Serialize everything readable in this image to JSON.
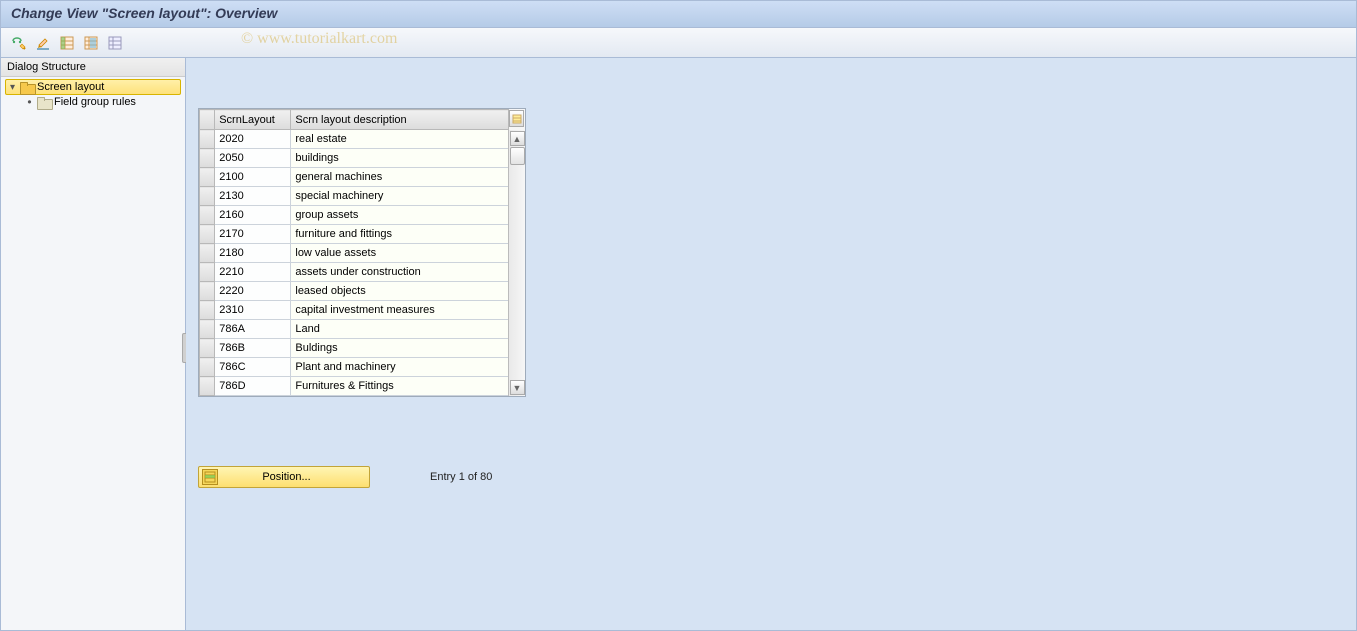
{
  "title": "Change View \"Screen layout\": Overview",
  "watermark": "© www.tutorialkart.com",
  "toolbar": {
    "icons": [
      "glasses-pencil",
      "pencil-underline",
      "table-select",
      "table-save",
      "table-list"
    ]
  },
  "sidebar": {
    "header": "Dialog Structure",
    "items": [
      {
        "label": "Screen layout",
        "selected": true,
        "expanded": true
      },
      {
        "label": "Field group rules",
        "selected": false,
        "child": true
      }
    ]
  },
  "table": {
    "columns": [
      "ScrnLayout",
      "Scrn layout description"
    ],
    "rows": [
      {
        "code": "2020",
        "desc": "real estate"
      },
      {
        "code": "2050",
        "desc": "buildings"
      },
      {
        "code": "2100",
        "desc": "general machines"
      },
      {
        "code": "2130",
        "desc": "special machinery"
      },
      {
        "code": "2160",
        "desc": "group assets"
      },
      {
        "code": "2170",
        "desc": "furniture and fittings"
      },
      {
        "code": "2180",
        "desc": "low value assets"
      },
      {
        "code": "2210",
        "desc": "assets under construction"
      },
      {
        "code": "2220",
        "desc": "leased objects"
      },
      {
        "code": "2310",
        "desc": "capital investment measures"
      },
      {
        "code": "786A",
        "desc": "Land"
      },
      {
        "code": "786B",
        "desc": "Buldings"
      },
      {
        "code": "786C",
        "desc": "Plant and machinery"
      },
      {
        "code": "786D",
        "desc": "Furnitures & Fittings"
      }
    ]
  },
  "position_button": "Position...",
  "entry_info": "Entry 1 of 80"
}
